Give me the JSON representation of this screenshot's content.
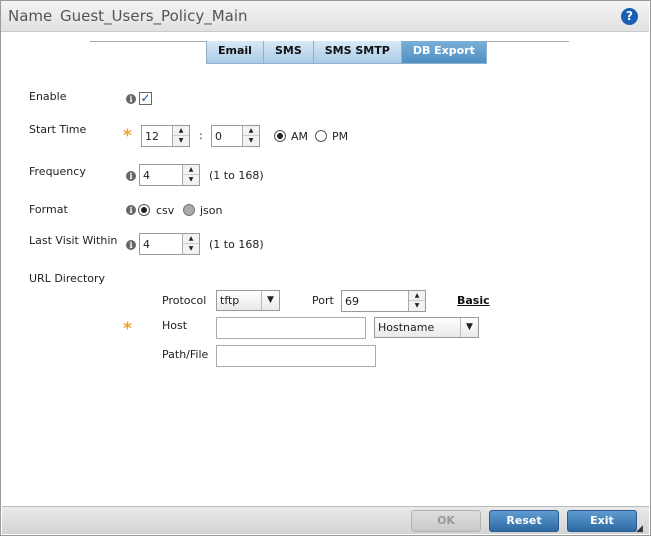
{
  "header": {
    "name_label": "Name",
    "name_value": "Guest_Users_Policy_Main",
    "help_glyph": "?"
  },
  "tabs": [
    {
      "label": "Email",
      "active": false
    },
    {
      "label": "SMS",
      "active": false
    },
    {
      "label": "SMS SMTP",
      "active": false
    },
    {
      "label": "DB Export",
      "active": true
    }
  ],
  "form": {
    "enable": {
      "label": "Enable",
      "checked": true
    },
    "start_time": {
      "label": "Start Time",
      "hour": "12",
      "separator": ":",
      "minute": "0",
      "am_label": "AM",
      "pm_label": "PM",
      "period": "AM"
    },
    "frequency": {
      "label": "Frequency",
      "value": "4",
      "range": "(1 to 168)"
    },
    "format": {
      "label": "Format",
      "csv_label": "csv",
      "json_label": "json",
      "selected": "csv"
    },
    "last_visit": {
      "label": "Last Visit Within",
      "value": "4",
      "range": "(1 to 168)"
    },
    "url_directory": {
      "label": "URL Directory",
      "protocol_label": "Protocol",
      "protocol_value": "tftp",
      "port_label": "Port",
      "port_value": "69",
      "basic_link": "Basic",
      "host_label": "Host",
      "host_value": "",
      "host_type_value": "Hostname",
      "path_label": "Path/File",
      "path_value": ""
    }
  },
  "footer": {
    "ok_label": "OK",
    "reset_label": "Reset",
    "exit_label": "Exit"
  },
  "colors": {
    "accent": "#2d6aa5",
    "required_star": "#f0a030",
    "active_tab": "#4e8fc4"
  }
}
